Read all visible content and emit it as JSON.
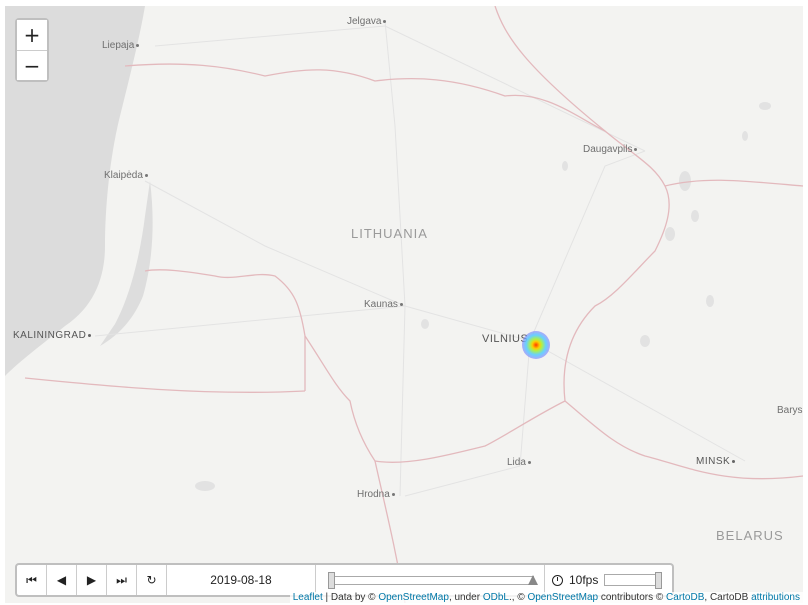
{
  "map": {
    "countries": [
      "LITHUANIA",
      "BELARUS"
    ],
    "big_cities": [
      "VILNIUS",
      "KALININGRAD",
      "MINSK"
    ],
    "cities": [
      "Jelgava",
      "Liepaja",
      "Daugavpils",
      "Klaipėda",
      "Kaunas",
      "Lida",
      "Hrodna",
      "Barys"
    ],
    "heat_color_stops": [
      "#ff3b00",
      "#ffcc00",
      "#aef04b",
      "#68d0ff",
      "#6e6eff"
    ]
  },
  "zoom": {
    "in_label": "+",
    "out_label": "−"
  },
  "player": {
    "btn_first": "⏮",
    "btn_back": "◀",
    "btn_play": "▶",
    "btn_forward": "⏭",
    "btn_loop": "↻",
    "date": "2019-08-18",
    "speed": "10fps"
  },
  "attribution": {
    "leaflet": "Leaflet",
    "sep1": " | Data by © ",
    "osm1": "OpenStreetMap",
    "under": ", under ",
    "odbl": "ODbL",
    "sep2": "., © ",
    "osm2": "OpenStreetMap",
    "contrib": " contributors © ",
    "cartodb": "CartoDB",
    "cartodb2": ", CartoDB ",
    "attributions": "attributions"
  }
}
